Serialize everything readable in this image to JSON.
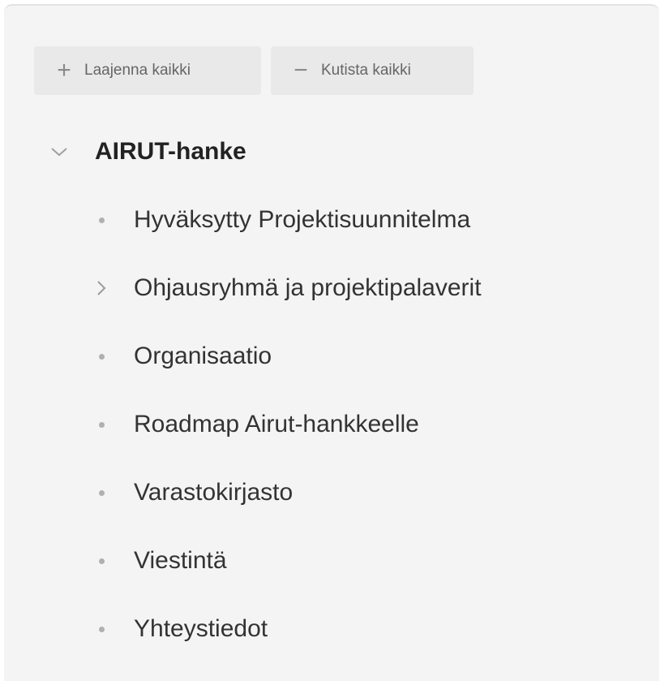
{
  "toolbar": {
    "expand_all": {
      "icon": "plus-icon",
      "glyph": "+",
      "label": "Laajenna kaikki"
    },
    "collapse_all": {
      "icon": "minus-icon",
      "glyph": "−",
      "label": "Kutista kaikki"
    }
  },
  "tree": {
    "root": {
      "label": "AIRUT-hanke",
      "expanded": true,
      "icon": "chevron-down-icon"
    },
    "children": [
      {
        "label": "Hyväksytty Projektisuunnitelma",
        "has_children": false,
        "icon": "bullet-icon"
      },
      {
        "label": "Ohjausryhmä ja projektipalaverit",
        "has_children": true,
        "icon": "chevron-right-icon"
      },
      {
        "label": "Organisaatio",
        "has_children": false,
        "icon": "bullet-icon"
      },
      {
        "label": "Roadmap Airut-hankkeelle",
        "has_children": false,
        "icon": "bullet-icon"
      },
      {
        "label": "Varastokirjasto",
        "has_children": false,
        "icon": "bullet-icon"
      },
      {
        "label": "Viestintä",
        "has_children": false,
        "icon": "bullet-icon"
      },
      {
        "label": "Yhteystiedot",
        "has_children": false,
        "icon": "bullet-icon"
      }
    ]
  },
  "colors": {
    "panel_background": "#f4f4f4",
    "button_background": "#e9e9e9",
    "icon_gray": "#a8a8a8",
    "text_dark": "#222222"
  }
}
